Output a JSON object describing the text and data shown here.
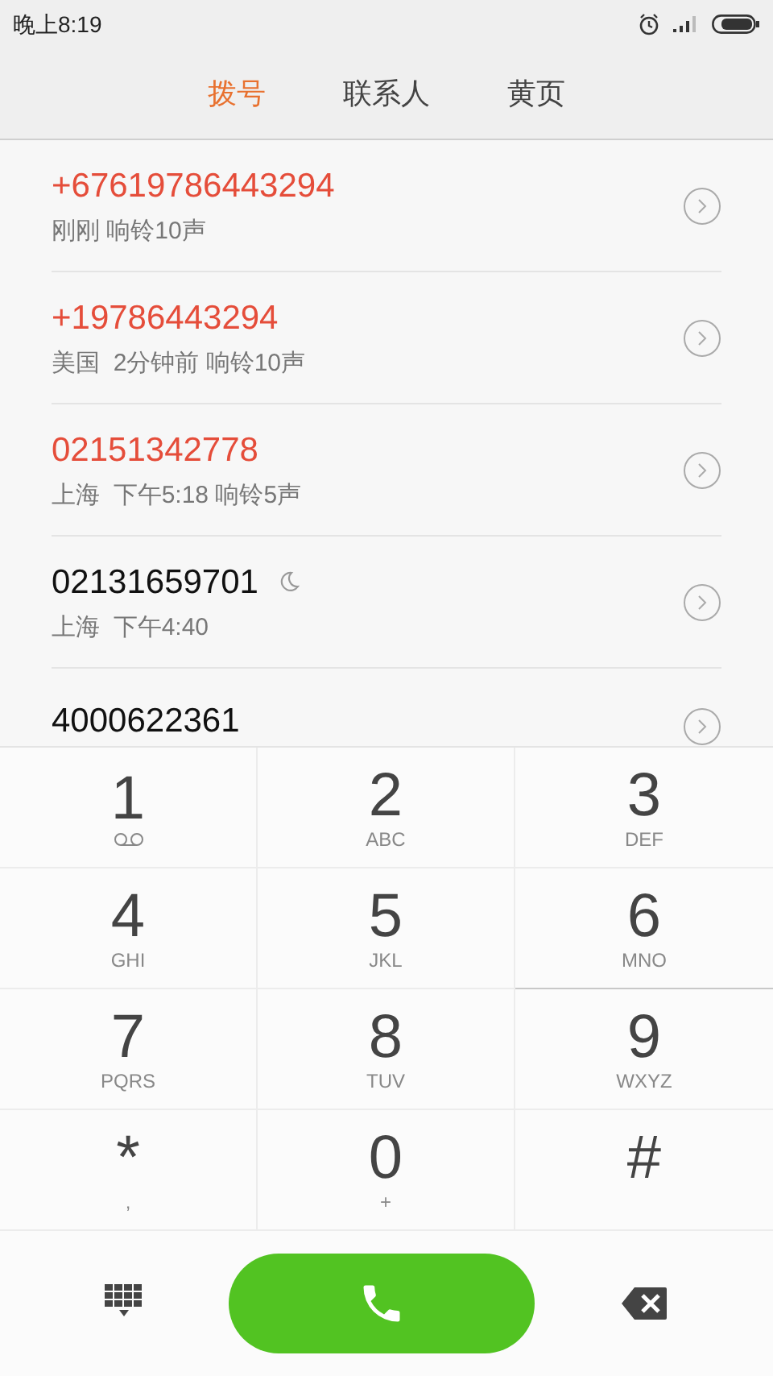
{
  "status_bar": {
    "time": "晚上8:19"
  },
  "tabs": [
    {
      "label": "拨号",
      "selected": true
    },
    {
      "label": "联系人",
      "selected": false
    },
    {
      "label": "黄页",
      "selected": false
    }
  ],
  "calls": [
    {
      "number": "+67619786443294",
      "detail": "刚刚 响铃10声",
      "missed": true,
      "quiet": false
    },
    {
      "number": "+19786443294",
      "detail": "美国  2分钟前 响铃10声",
      "missed": true,
      "quiet": false
    },
    {
      "number": "02151342778",
      "detail": "上海  下午5:18 响铃5声",
      "missed": true,
      "quiet": false
    },
    {
      "number": "02131659701",
      "detail": "上海  下午4:40",
      "missed": false,
      "quiet": true
    },
    {
      "number": "4000622361",
      "missed": false,
      "quiet": false
    }
  ],
  "keypad": [
    {
      "digit": "1",
      "kind": "voicemail"
    },
    {
      "digit": "2",
      "letters": "ABC"
    },
    {
      "digit": "3",
      "letters": "DEF"
    },
    {
      "digit": "4",
      "letters": "GHI"
    },
    {
      "digit": "5",
      "letters": "JKL"
    },
    {
      "digit": "6",
      "letters": "MNO"
    },
    {
      "digit": "7",
      "letters": "PQRS"
    },
    {
      "digit": "8",
      "letters": "TUV"
    },
    {
      "digit": "9",
      "letters": "WXYZ"
    },
    {
      "digit": "*",
      "letters": ","
    },
    {
      "digit": "0",
      "letters": "+"
    },
    {
      "digit": "#"
    }
  ]
}
